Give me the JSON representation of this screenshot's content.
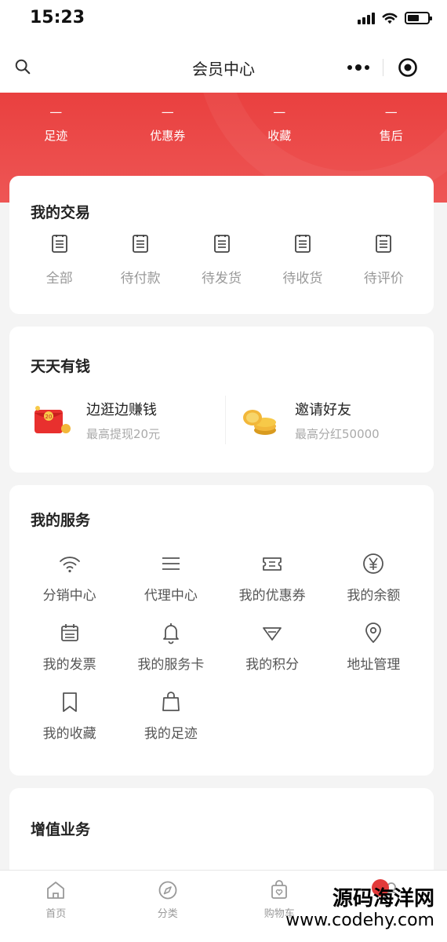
{
  "status_bar": {
    "time": "15:23"
  },
  "nav": {
    "title": "会员中心",
    "search_icon": "search-icon",
    "more_icon": "more-dots-icon",
    "target_icon": "target-icon"
  },
  "header": {
    "stats": [
      {
        "value": "—",
        "label": "足迹"
      },
      {
        "value": "—",
        "label": "优惠券"
      },
      {
        "value": "—",
        "label": "收藏"
      },
      {
        "value": "—",
        "label": "售后"
      }
    ],
    "color": "#e9403f"
  },
  "trade": {
    "title": "我的交易",
    "items": [
      {
        "label": "全部",
        "icon": "clipboard-icon"
      },
      {
        "label": "待付款",
        "icon": "clipboard-icon"
      },
      {
        "label": "待发货",
        "icon": "clipboard-icon"
      },
      {
        "label": "待收货",
        "icon": "clipboard-icon"
      },
      {
        "label": "待评价",
        "icon": "clipboard-icon"
      }
    ]
  },
  "money": {
    "title": "天天有钱",
    "items": [
      {
        "title": "边逛边赚钱",
        "subtitle": "最高提现20元",
        "icon": "red-packet-icon"
      },
      {
        "title": "邀请好友",
        "subtitle": "最高分红50000",
        "icon": "gold-coins-icon"
      }
    ]
  },
  "service": {
    "title": "我的服务",
    "items": [
      {
        "label": "分销中心",
        "icon": "wifi-icon"
      },
      {
        "label": "代理中心",
        "icon": "menu-lines-icon"
      },
      {
        "label": "我的优惠券",
        "icon": "ticket-icon"
      },
      {
        "label": "我的余额",
        "icon": "yen-icon"
      },
      {
        "label": "我的发票",
        "icon": "invoice-icon"
      },
      {
        "label": "我的服务卡",
        "icon": "bell-icon"
      },
      {
        "label": "我的积分",
        "icon": "diamond-icon"
      },
      {
        "label": "地址管理",
        "icon": "location-pin-icon"
      },
      {
        "label": "我的收藏",
        "icon": "bookmark-icon"
      },
      {
        "label": "我的足迹",
        "icon": "bag-icon"
      }
    ]
  },
  "value_added": {
    "title": "增值业务"
  },
  "tabbar": {
    "tabs": [
      {
        "label": "首页",
        "icon": "home-icon"
      },
      {
        "label": "分类",
        "icon": "compass-icon"
      },
      {
        "label": "购物车",
        "icon": "shopping-bag-icon"
      },
      {
        "label": "",
        "icon": "user-icon"
      }
    ]
  },
  "watermark": {
    "name": "源码海洋网",
    "url": "www.codehy.com"
  }
}
